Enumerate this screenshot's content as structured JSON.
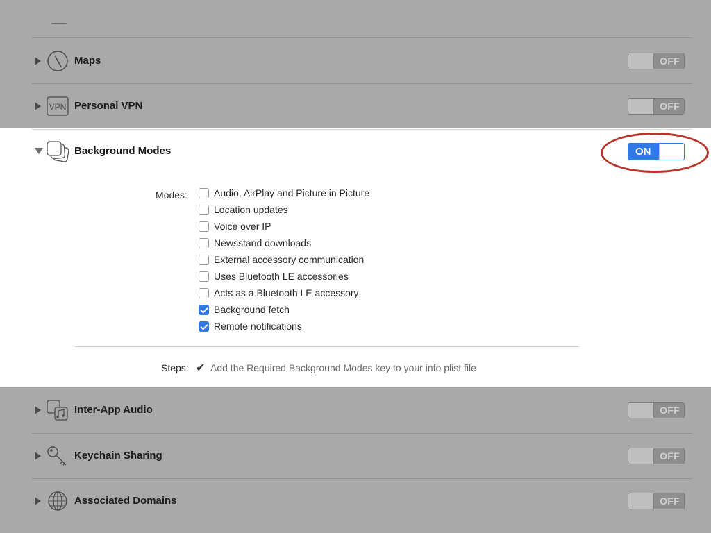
{
  "capabilities": [
    {
      "title": "Maps",
      "state": "OFF",
      "icon": "compass-icon"
    },
    {
      "title": "Personal VPN",
      "state": "OFF",
      "icon": "vpn-icon"
    },
    {
      "title": "Background Modes",
      "state": "ON",
      "icon": "background-modes-icon"
    },
    {
      "title": "Inter-App Audio",
      "state": "OFF",
      "icon": "inter-app-audio-icon"
    },
    {
      "title": "Keychain Sharing",
      "state": "OFF",
      "icon": "key-icon"
    },
    {
      "title": "Associated Domains",
      "state": "OFF",
      "icon": "globe-icon"
    }
  ],
  "background_modes": {
    "modes_label": "Modes:",
    "modes": [
      {
        "label": "Audio, AirPlay and Picture in Picture",
        "checked": false
      },
      {
        "label": "Location updates",
        "checked": false
      },
      {
        "label": "Voice over IP",
        "checked": false
      },
      {
        "label": "Newsstand downloads",
        "checked": false
      },
      {
        "label": "External accessory communication",
        "checked": false
      },
      {
        "label": "Uses Bluetooth LE accessories",
        "checked": false
      },
      {
        "label": "Acts as a Bluetooth LE accessory",
        "checked": false
      },
      {
        "label": "Background fetch",
        "checked": true
      },
      {
        "label": "Remote notifications",
        "checked": true
      }
    ],
    "steps_label": "Steps:",
    "steps_check": "✔",
    "steps_text": "Add the Required Background Modes key to your info plist file"
  },
  "icon_text": {
    "vpn": "VPN"
  },
  "colors": {
    "accent": "#2f7ae5",
    "highlight_callout": "#b8352c",
    "dimmed_background": "#a9a9a9"
  }
}
